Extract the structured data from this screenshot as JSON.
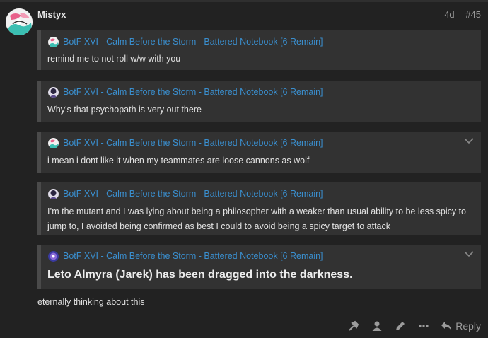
{
  "post": {
    "username": "Mistyx",
    "age": "4d",
    "number": "#45",
    "reply_text": "eternally thinking about this"
  },
  "quotes": [
    {
      "title": "BotF XVI - Calm Before the Storm - Battered Notebook [6 Remain]",
      "body": "remind me to not roll w/w with you"
    },
    {
      "title": "BotF XVI - Calm Before the Storm - Battered Notebook [6 Remain]",
      "body": "Why’s that psychopath is very out there"
    },
    {
      "title": "BotF XVI - Calm Before the Storm - Battered Notebook [6 Remain]",
      "body": "i mean i dont like it when my teammates are loose cannons as wolf"
    },
    {
      "title": "BotF XVI - Calm Before the Storm - Battered Notebook [6 Remain]",
      "body": "I’m the mutant and I was lying about being a philosopher with a weaker than usual ability to be less spicy to jump to, I avoided being confirmed as best I could to avoid being a spicy target to attack"
    },
    {
      "title": "BotF XVI - Calm Before the Storm - Battered Notebook [6 Remain]",
      "body": "Leto Almyra (Jarek) has been dragged into the darkness."
    }
  ],
  "actions": {
    "reply_label": "Reply"
  },
  "colors": {
    "background": "#222222",
    "quote_bg": "#323232",
    "link": "#3a8fcf",
    "muted": "#9a9a9a"
  }
}
